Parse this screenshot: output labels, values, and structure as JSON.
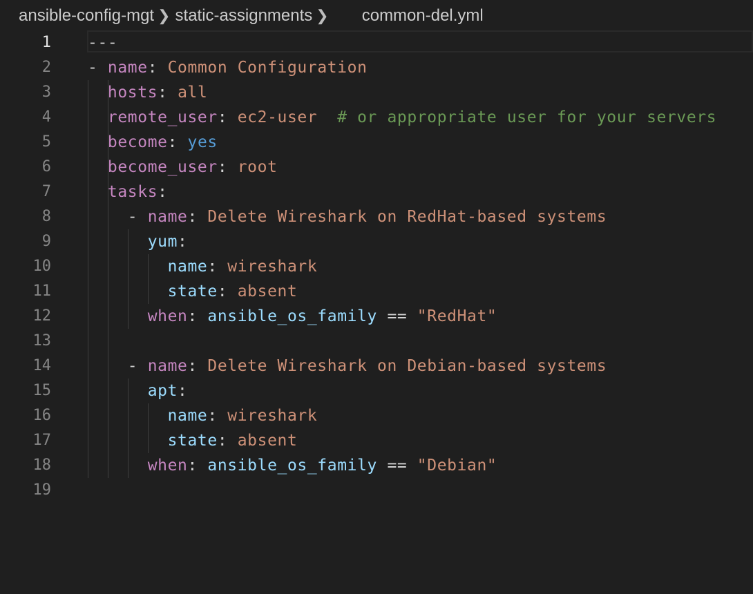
{
  "breadcrumb": {
    "items": [
      "ansible-config-mgt",
      "static-assignments"
    ],
    "file": "common-del.yml"
  },
  "editor": {
    "current_line": 1,
    "lines": [
      {
        "n": "1",
        "tokens": [
          {
            "t": "---",
            "c": "t-dash"
          }
        ]
      },
      {
        "n": "2",
        "tokens": [
          {
            "t": "- ",
            "c": "t-punc"
          },
          {
            "t": "name",
            "c": "t-key"
          },
          {
            "t": ": ",
            "c": "t-punc"
          },
          {
            "t": "Common Configuration",
            "c": "t-str"
          }
        ]
      },
      {
        "n": "3",
        "tokens": [
          {
            "t": "  ",
            "c": "t-punc"
          },
          {
            "t": "hosts",
            "c": "t-key"
          },
          {
            "t": ": ",
            "c": "t-punc"
          },
          {
            "t": "all",
            "c": "t-str"
          }
        ]
      },
      {
        "n": "4",
        "tokens": [
          {
            "t": "  ",
            "c": "t-punc"
          },
          {
            "t": "remote_user",
            "c": "t-key"
          },
          {
            "t": ": ",
            "c": "t-punc"
          },
          {
            "t": "ec2-user",
            "c": "t-str"
          },
          {
            "t": "  ",
            "c": "t-punc"
          },
          {
            "t": "# or appropriate user for your servers",
            "c": "t-com"
          }
        ]
      },
      {
        "n": "5",
        "tokens": [
          {
            "t": "  ",
            "c": "t-punc"
          },
          {
            "t": "become",
            "c": "t-key"
          },
          {
            "t": ": ",
            "c": "t-punc"
          },
          {
            "t": "yes",
            "c": "t-bool"
          }
        ]
      },
      {
        "n": "6",
        "tokens": [
          {
            "t": "  ",
            "c": "t-punc"
          },
          {
            "t": "become_user",
            "c": "t-key"
          },
          {
            "t": ": ",
            "c": "t-punc"
          },
          {
            "t": "root",
            "c": "t-str"
          }
        ]
      },
      {
        "n": "7",
        "tokens": [
          {
            "t": "  ",
            "c": "t-punc"
          },
          {
            "t": "tasks",
            "c": "t-key"
          },
          {
            "t": ":",
            "c": "t-punc"
          }
        ]
      },
      {
        "n": "8",
        "tokens": [
          {
            "t": "    - ",
            "c": "t-punc"
          },
          {
            "t": "name",
            "c": "t-key"
          },
          {
            "t": ": ",
            "c": "t-punc"
          },
          {
            "t": "Delete Wireshark on RedHat-based systems",
            "c": "t-str"
          }
        ]
      },
      {
        "n": "9",
        "tokens": [
          {
            "t": "      ",
            "c": "t-punc"
          },
          {
            "t": "yum",
            "c": "t-key2"
          },
          {
            "t": ":",
            "c": "t-punc"
          }
        ]
      },
      {
        "n": "10",
        "tokens": [
          {
            "t": "        ",
            "c": "t-punc"
          },
          {
            "t": "name",
            "c": "t-key2"
          },
          {
            "t": ": ",
            "c": "t-punc"
          },
          {
            "t": "wireshark",
            "c": "t-str"
          }
        ]
      },
      {
        "n": "11",
        "tokens": [
          {
            "t": "        ",
            "c": "t-punc"
          },
          {
            "t": "state",
            "c": "t-key2"
          },
          {
            "t": ": ",
            "c": "t-punc"
          },
          {
            "t": "absent",
            "c": "t-str"
          }
        ]
      },
      {
        "n": "12",
        "tokens": [
          {
            "t": "      ",
            "c": "t-punc"
          },
          {
            "t": "when",
            "c": "t-key"
          },
          {
            "t": ": ",
            "c": "t-punc"
          },
          {
            "t": "ansible_os_family",
            "c": "t-var"
          },
          {
            "t": " == ",
            "c": "t-punc"
          },
          {
            "t": "\"RedHat\"",
            "c": "t-str"
          }
        ]
      },
      {
        "n": "13",
        "tokens": []
      },
      {
        "n": "14",
        "tokens": [
          {
            "t": "    - ",
            "c": "t-punc"
          },
          {
            "t": "name",
            "c": "t-key"
          },
          {
            "t": ": ",
            "c": "t-punc"
          },
          {
            "t": "Delete Wireshark on Debian-based systems",
            "c": "t-str"
          }
        ]
      },
      {
        "n": "15",
        "tokens": [
          {
            "t": "      ",
            "c": "t-punc"
          },
          {
            "t": "apt",
            "c": "t-key2"
          },
          {
            "t": ":",
            "c": "t-punc"
          }
        ]
      },
      {
        "n": "16",
        "tokens": [
          {
            "t": "        ",
            "c": "t-punc"
          },
          {
            "t": "name",
            "c": "t-key2"
          },
          {
            "t": ": ",
            "c": "t-punc"
          },
          {
            "t": "wireshark",
            "c": "t-str"
          }
        ]
      },
      {
        "n": "17",
        "tokens": [
          {
            "t": "        ",
            "c": "t-punc"
          },
          {
            "t": "state",
            "c": "t-key2"
          },
          {
            "t": ": ",
            "c": "t-punc"
          },
          {
            "t": "absent",
            "c": "t-str"
          }
        ]
      },
      {
        "n": "18",
        "tokens": [
          {
            "t": "      ",
            "c": "t-punc"
          },
          {
            "t": "when",
            "c": "t-key"
          },
          {
            "t": ": ",
            "c": "t-punc"
          },
          {
            "t": "ansible_os_family",
            "c": "t-var"
          },
          {
            "t": " == ",
            "c": "t-punc"
          },
          {
            "t": "\"Debian\"",
            "c": "t-str"
          }
        ]
      },
      {
        "n": "19",
        "tokens": []
      }
    ]
  },
  "colors": {
    "background": "#1f1f1f",
    "line_number": "#858585",
    "key": "#c586c0",
    "nested_key": "#9cdcfe",
    "string": "#ce9178",
    "boolean": "#569cd6",
    "comment": "#6a9955"
  }
}
